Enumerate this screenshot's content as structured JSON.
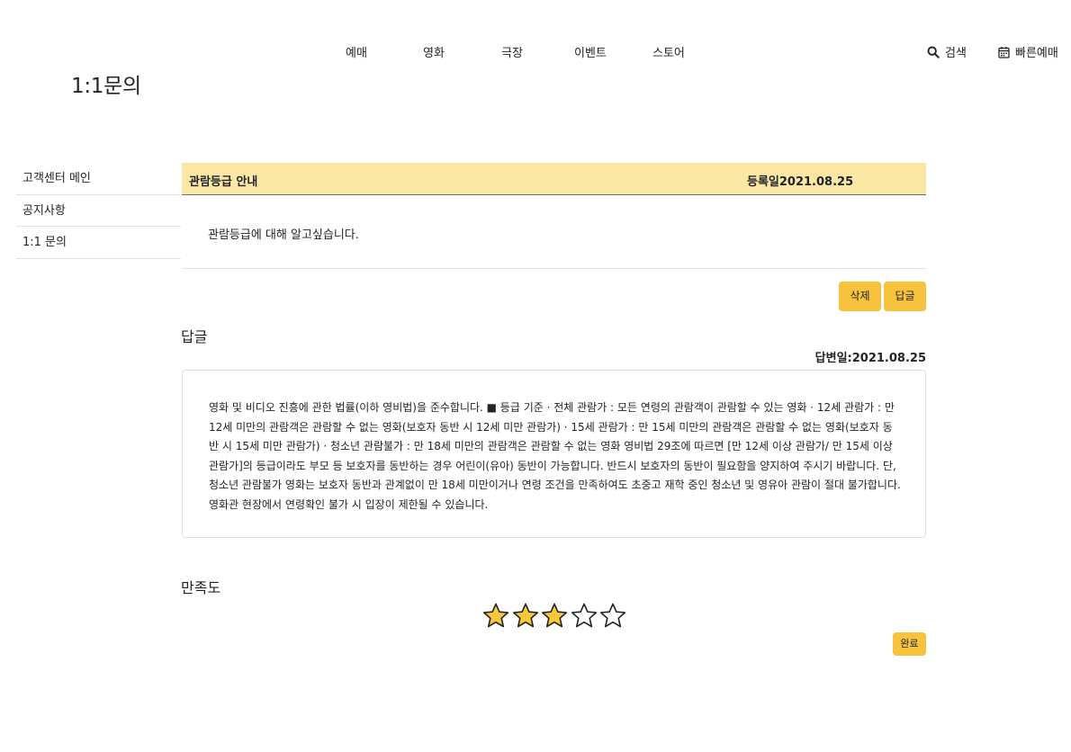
{
  "nav": {
    "menu": [
      "예매",
      "영화",
      "극장",
      "이벤트",
      "스토어"
    ],
    "search_label": "검색",
    "quick_booking_label": "빠른예매"
  },
  "page_title": "1:1문의",
  "sidebar": {
    "items": [
      {
        "label": "고객센터 메인"
      },
      {
        "label": "공지사항"
      },
      {
        "label": "1:1 문의"
      }
    ]
  },
  "question": {
    "title": "관람등급 안내",
    "date": "등록일2021.08.25",
    "content": "관람등급에 대해 알고싶습니다.",
    "delete_label": "삭제",
    "reply_label": "답글"
  },
  "reply": {
    "section_title": "답글",
    "date": "답변일:2021.08.25",
    "content": "영화 및 비디오 진흥에 관한 법률(이하 영비법)을 준수합니다. ■ 등급 기준 · 전체 관람가 : 모든 연령의 관람객이 관람할 수 있는 영화 · 12세 관람가 : 만 12세 미만의 관람객은 관람할 수 없는 영화(보호자 동반 시 12세 미만 관람가) · 15세 관람가 : 만 15세 미만의 관람객은 관람할 수 없는 영화(보호자 동반 시 15세 미만 관람가) · 청소년 관람불가 : 만 18세 미만의 관람객은 관람할 수 없는 영화 영비법 29조에 따르면 [만 12세 이상 관람가/ 만 15세 이상 관람가]의 등급이라도 부모 등 보호자를 동반하는 경우 어린이(유아) 동반이 가능합니다. 반드시 보호자의 동반이 필요함을 양지하여 주시기 바랍니다. 단, 청소년 관람불가 영화는 보호자 동반과 관계없이 만 18세 미만이거나 연령 조건을 만족하여도 초중고 재학 중인 청소년 및 영유아 관람이 절대 불가합니다. 영화관 현장에서 연령확인 불가 시 입장이 제한될 수 있습니다."
  },
  "satisfaction": {
    "section_title": "만족도",
    "rating": 3,
    "max_rating": 5,
    "star_filled_color": "#f7c83a",
    "done_label": "완료"
  },
  "colors": {
    "accent_button": "#f7c23c",
    "question_header_bg": "#fbe7a4"
  }
}
